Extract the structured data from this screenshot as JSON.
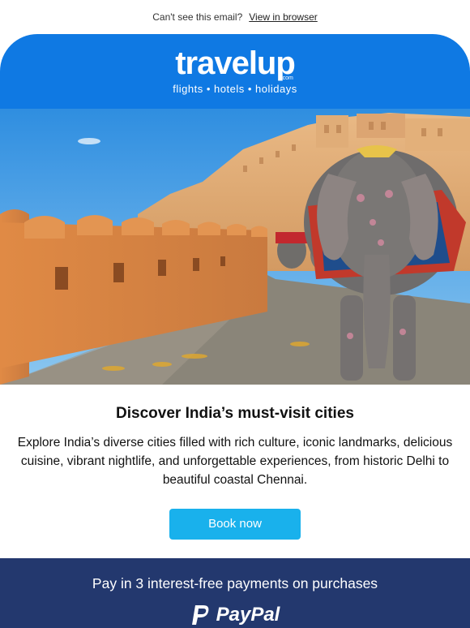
{
  "preheader": {
    "text": "Can't see this email?",
    "link": "View in browser"
  },
  "header": {
    "logo_text": "travelup",
    "logo_suffix": ".com",
    "tagline": "flights  •  hotels  •  holidays",
    "background": "#0f79e3"
  },
  "hero": {
    "icon": "india-elephant-fort-photo"
  },
  "main": {
    "title": "Discover India’s must-visit cities",
    "body": "Explore India’s diverse cities filled with rich culture, iconic landmarks, delicious cuisine, vibrant nightlife, and unforgettable experiences, from historic Delhi to beautiful coastal Chennai.",
    "cta_label": "Book now",
    "cta_color": "#19b1ec"
  },
  "footer": {
    "text": "Pay in 3 interest-free payments on purchases",
    "brand": "PayPal",
    "background": "#23386e"
  }
}
